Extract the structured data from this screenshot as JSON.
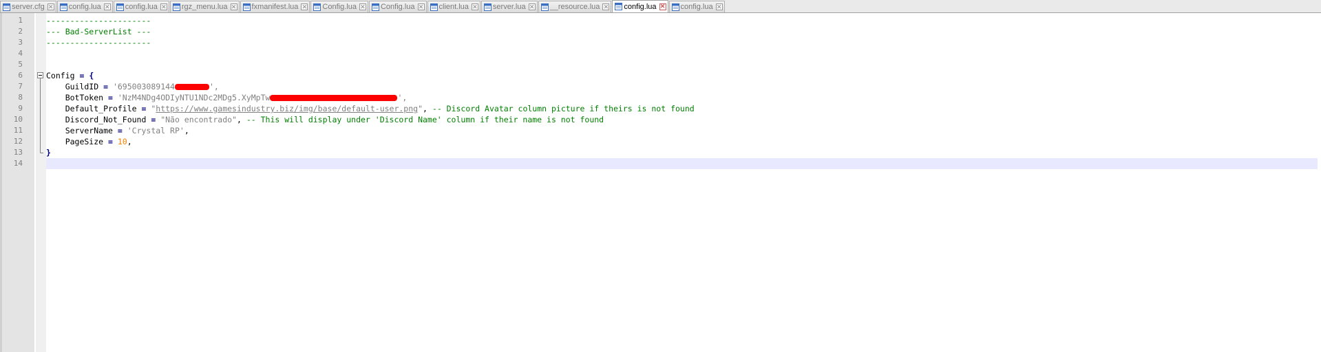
{
  "tabs": [
    {
      "label": "server.cfg",
      "active": false
    },
    {
      "label": "config.lua",
      "active": false
    },
    {
      "label": "config.lua",
      "active": false
    },
    {
      "label": "rgz_menu.lua",
      "active": false
    },
    {
      "label": "fxmanifest.lua",
      "active": false
    },
    {
      "label": "Config.lua",
      "active": false
    },
    {
      "label": "Config.lua",
      "active": false
    },
    {
      "label": "client.lua",
      "active": false
    },
    {
      "label": "server.lua",
      "active": false
    },
    {
      "label": "__resource.lua",
      "active": false
    },
    {
      "label": "config.lua",
      "active": true
    },
    {
      "label": "config.lua",
      "active": false
    }
  ],
  "editor": {
    "current_line": 14,
    "lines": [
      {
        "num": "1",
        "segments": [
          {
            "text": "----------------------",
            "cls": "c-comment"
          }
        ]
      },
      {
        "num": "2",
        "segments": [
          {
            "text": "--- Bad-ServerList ---",
            "cls": "c-comment"
          }
        ]
      },
      {
        "num": "3",
        "segments": [
          {
            "text": "----------------------",
            "cls": "c-comment"
          }
        ]
      },
      {
        "num": "4",
        "segments": []
      },
      {
        "num": "5",
        "segments": []
      },
      {
        "num": "6",
        "fold": "open",
        "segments": [
          {
            "text": "Config ",
            "cls": ""
          },
          {
            "text": "=",
            "cls": "c-op"
          },
          {
            "text": " {",
            "cls": "c-op"
          }
        ]
      },
      {
        "num": "7",
        "fold": "line",
        "segments": [
          {
            "text": "    GuildID ",
            "cls": ""
          },
          {
            "text": "=",
            "cls": "c-op"
          },
          {
            "text": " '695003089144",
            "cls": "c-string"
          },
          {
            "redact": 50
          },
          {
            "text": "',",
            "cls": "c-string"
          }
        ]
      },
      {
        "num": "8",
        "fold": "line",
        "segments": [
          {
            "text": "    BotToken ",
            "cls": ""
          },
          {
            "text": "=",
            "cls": "c-op"
          },
          {
            "text": " 'NzM4NDg4ODIyNTU1NDc2MDg5.XyMpTw",
            "cls": "c-string"
          },
          {
            "redact": 185
          },
          {
            "text": "',",
            "cls": "c-string"
          }
        ]
      },
      {
        "num": "9",
        "fold": "line",
        "segments": [
          {
            "text": "    Default_Profile ",
            "cls": ""
          },
          {
            "text": "=",
            "cls": "c-op"
          },
          {
            "text": " \"",
            "cls": "c-string"
          },
          {
            "text": "https://www.gamesindustry.biz/img/base/default-user.png",
            "cls": "c-link"
          },
          {
            "text": "\"",
            "cls": "c-string"
          },
          {
            "text": ", ",
            "cls": ""
          },
          {
            "text": "-- Discord Avatar column picture if theirs is not found",
            "cls": "c-comment"
          }
        ]
      },
      {
        "num": "10",
        "fold": "line",
        "segments": [
          {
            "text": "    Discord_Not_Found ",
            "cls": ""
          },
          {
            "text": "=",
            "cls": "c-op"
          },
          {
            "text": " \"Não encontrado\"",
            "cls": "c-string"
          },
          {
            "text": ", ",
            "cls": ""
          },
          {
            "text": "-- This will display under 'Discord Name' column if their name is not found",
            "cls": "c-comment"
          }
        ]
      },
      {
        "num": "11",
        "fold": "line",
        "segments": [
          {
            "text": "    ServerName ",
            "cls": ""
          },
          {
            "text": "=",
            "cls": "c-op"
          },
          {
            "text": " 'Crystal RP'",
            "cls": "c-string"
          },
          {
            "text": ",",
            "cls": ""
          }
        ]
      },
      {
        "num": "12",
        "fold": "line",
        "segments": [
          {
            "text": "    PageSize ",
            "cls": ""
          },
          {
            "text": "=",
            "cls": "c-op"
          },
          {
            "text": " ",
            "cls": ""
          },
          {
            "text": "10",
            "cls": "c-num"
          },
          {
            "text": ",",
            "cls": ""
          }
        ]
      },
      {
        "num": "13",
        "fold": "end",
        "segments": [
          {
            "text": "}",
            "cls": "c-op"
          }
        ]
      },
      {
        "num": "14",
        "segments": []
      }
    ]
  },
  "colors": {
    "comment": "#008000",
    "string": "#808080",
    "number": "#ff8000",
    "operator": "#000080",
    "current_line_bg": "#e8e8ff",
    "redaction": "#ff0000"
  },
  "icons": {
    "tab_file": "file-icon",
    "tab_close": "close-icon",
    "fold_open": "fold-minus-icon"
  }
}
